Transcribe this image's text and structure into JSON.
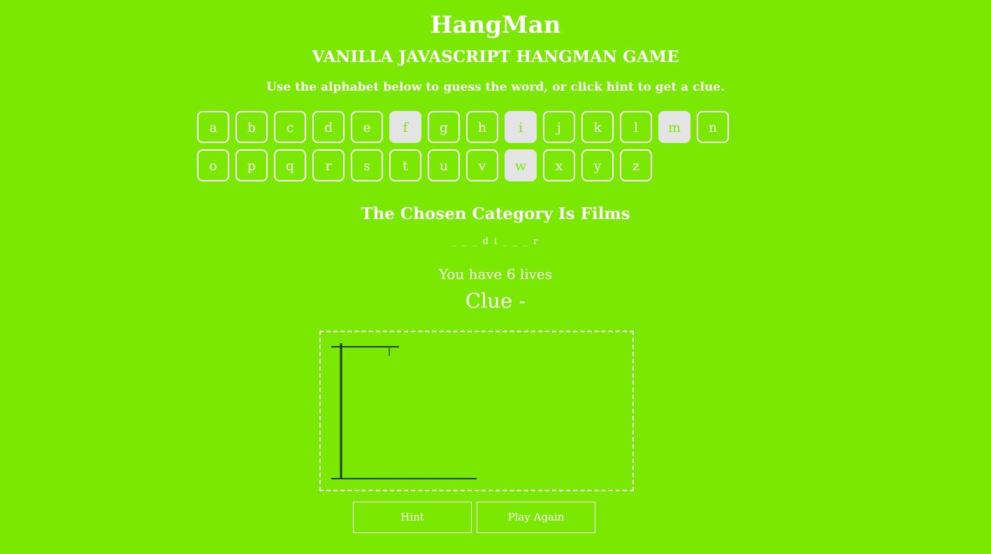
{
  "header": {
    "title": "HangMan",
    "subtitle": "VANILLA JAVASCRIPT HANGMAN GAME",
    "instructions": "Use the alphabet below to guess the word, or click hint to get a clue."
  },
  "alphabet": [
    {
      "letter": "a",
      "used": false
    },
    {
      "letter": "b",
      "used": false
    },
    {
      "letter": "c",
      "used": false
    },
    {
      "letter": "d",
      "used": false
    },
    {
      "letter": "e",
      "used": false
    },
    {
      "letter": "f",
      "used": true
    },
    {
      "letter": "g",
      "used": false
    },
    {
      "letter": "h",
      "used": false
    },
    {
      "letter": "i",
      "used": true
    },
    {
      "letter": "j",
      "used": false
    },
    {
      "letter": "k",
      "used": false
    },
    {
      "letter": "l",
      "used": false
    },
    {
      "letter": "m",
      "used": true
    },
    {
      "letter": "n",
      "used": false
    },
    {
      "letter": "o",
      "used": false
    },
    {
      "letter": "p",
      "used": false
    },
    {
      "letter": "q",
      "used": false
    },
    {
      "letter": "r",
      "used": false
    },
    {
      "letter": "s",
      "used": false
    },
    {
      "letter": "t",
      "used": false
    },
    {
      "letter": "u",
      "used": false
    },
    {
      "letter": "v",
      "used": false
    },
    {
      "letter": "w",
      "used": true
    },
    {
      "letter": "x",
      "used": false
    },
    {
      "letter": "y",
      "used": false
    },
    {
      "letter": "z",
      "used": false
    }
  ],
  "game": {
    "category": "The Chosen Category Is Films",
    "guess": "_ _ _ d i _ _ _ r",
    "lives": "You have 6 lives",
    "clue": "Clue -"
  },
  "buttons": {
    "hint": "Hint",
    "play_again": "Play Again"
  },
  "colors": {
    "background": "#7ae800",
    "text": "#ffffff",
    "used_letter_bg": "#e4e4e4",
    "gallows": "#1a3d00"
  }
}
